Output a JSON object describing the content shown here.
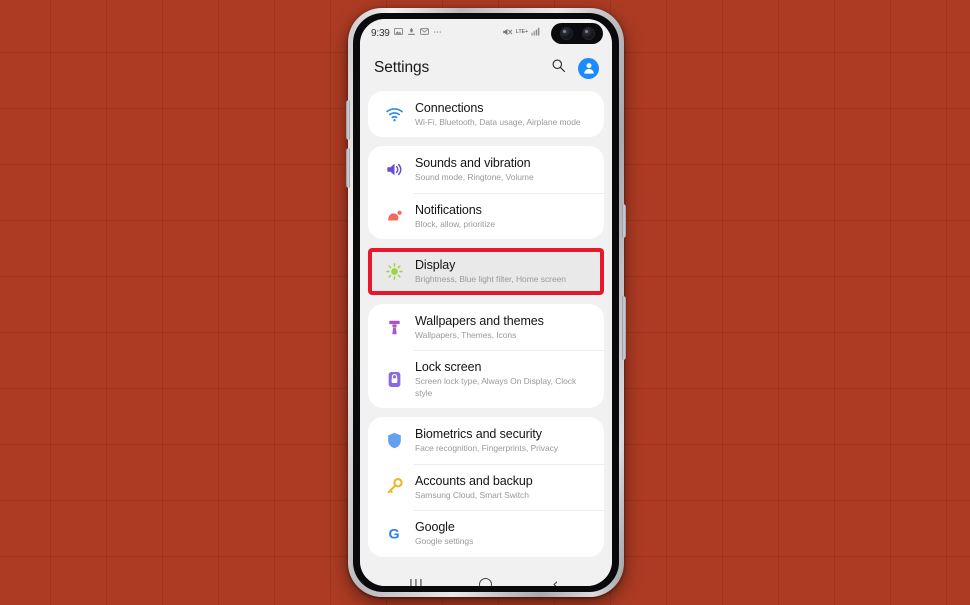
{
  "status_bar": {
    "clock": "9:39",
    "left_icons": [
      "photo-icon",
      "download-icon",
      "mail-icon",
      "more-icon"
    ],
    "network_label": "LTE+",
    "right_icons": [
      "mute-icon",
      "signal-icon"
    ]
  },
  "header": {
    "title": "Settings",
    "search_icon": "search-icon",
    "avatar_icon": "account-avatar-icon"
  },
  "groups": [
    {
      "items": [
        {
          "icon": "wifi-icon",
          "icon_color": "#2a8cf0",
          "title": "Connections",
          "subtitle": "Wi-Fi, Bluetooth, Data usage, Airplane mode",
          "highlighted": false
        }
      ]
    },
    {
      "items": [
        {
          "icon": "speaker-icon",
          "icon_color": "#6a4ad6",
          "title": "Sounds and vibration",
          "subtitle": "Sound mode, Ringtone, Volume",
          "highlighted": false
        },
        {
          "icon": "notification-icon",
          "icon_color": "#f4695e",
          "title": "Notifications",
          "subtitle": "Block, allow, prioritize",
          "highlighted": false
        }
      ]
    },
    {
      "items": [
        {
          "icon": "brightness-sun-icon",
          "icon_color": "#8bc63f",
          "title": "Display",
          "subtitle": "Brightness, Blue light filter, Home screen",
          "highlighted": true
        }
      ]
    },
    {
      "items": [
        {
          "icon": "paint-roller-icon",
          "icon_color": "#a855c9",
          "title": "Wallpapers and themes",
          "subtitle": "Wallpapers, Themes, Icons",
          "highlighted": false
        },
        {
          "icon": "lock-icon",
          "icon_color": "#8a6ae0",
          "title": "Lock screen",
          "subtitle": "Screen lock type, Always On Display, Clock style",
          "highlighted": false
        }
      ]
    },
    {
      "items": [
        {
          "icon": "shield-icon",
          "icon_color": "#63a0f0",
          "title": "Biometrics and security",
          "subtitle": "Face recognition, Fingerprints, Privacy",
          "highlighted": false
        },
        {
          "icon": "key-icon",
          "icon_color": "#f0b429",
          "title": "Accounts and backup",
          "subtitle": "Samsung Cloud, Smart Switch",
          "highlighted": false
        },
        {
          "icon": "google-g-icon",
          "icon_color": "#2a7df0",
          "title": "Google",
          "subtitle": "Google settings",
          "highlighted": false
        }
      ]
    }
  ],
  "nav_bar": {
    "recents_label": "|||",
    "recents_icon": "recents-icon",
    "home_icon": "home-icon",
    "back_label": "‹",
    "back_icon": "back-icon"
  },
  "annotation": {
    "highlight_color": "#e8182b",
    "target": "Display"
  },
  "backdrop": {
    "color": "#ad3b23"
  }
}
